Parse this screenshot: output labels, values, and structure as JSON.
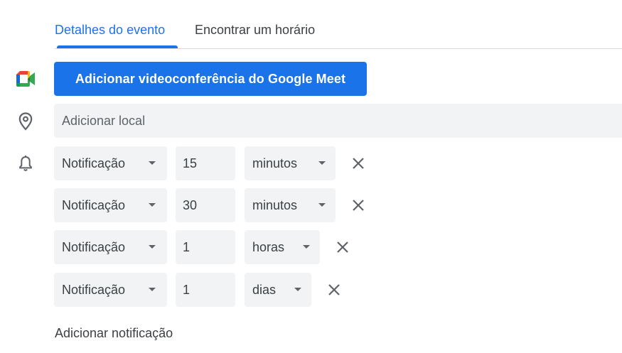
{
  "tabs": [
    {
      "label": "Detalhes do evento",
      "active": true
    },
    {
      "label": "Encontrar um horário",
      "active": false
    }
  ],
  "meet_button": {
    "label": "Adicionar videoconferência do Google Meet",
    "color": "#1a73e8"
  },
  "location": {
    "placeholder": "Adicionar local",
    "value": ""
  },
  "notifications": [
    {
      "type": "Notificação",
      "amount": "15",
      "unit": "minutos"
    },
    {
      "type": "Notificação",
      "amount": "30",
      "unit": "minutos"
    },
    {
      "type": "Notificação",
      "amount": "1",
      "unit": "horas"
    },
    {
      "type": "Notificação",
      "amount": "1",
      "unit": "dias"
    }
  ],
  "add_notification": {
    "label": "Adicionar notificação"
  },
  "icons": {
    "meet": "google-meet-icon",
    "location": "location-pin-icon",
    "notification": "bell-icon",
    "close": "close-icon",
    "dropdown": "dropdown-caret-icon"
  },
  "colors": {
    "accent": "#1a73e8",
    "field_bg": "#f1f3f4",
    "text": "#3c4043"
  }
}
